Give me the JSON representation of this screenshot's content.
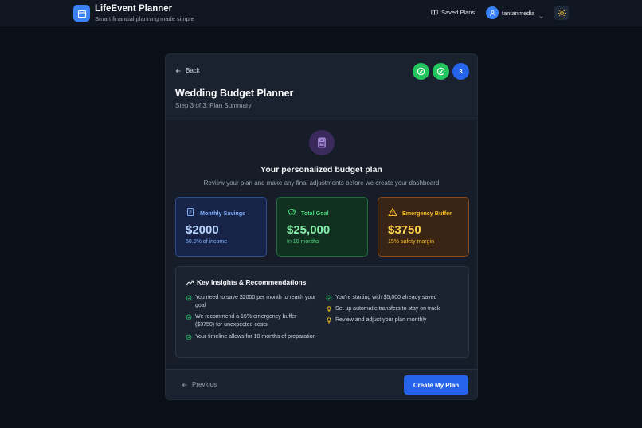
{
  "app": {
    "title": "LifeEvent Planner",
    "subtitle": "Smart financial planning made simple"
  },
  "topnav": {
    "saved_plans": "Saved Plans",
    "username": "tantanmedia"
  },
  "card": {
    "back_label": "Back",
    "title": "Wedding Budget Planner",
    "step_text": "Step 3 of 3: Plan Summary",
    "steps": [
      {
        "state": "complete"
      },
      {
        "state": "complete"
      },
      {
        "label": "3",
        "state": "current"
      }
    ]
  },
  "summary": {
    "title": "Your personalized budget plan",
    "subtitle": "Review your plan and make any final adjustments before we create your dashboard"
  },
  "stats": [
    {
      "label": "Monthly Savings",
      "value": "$2000",
      "note": "50.0% of income",
      "color": "#3b82f6",
      "icon": "document-icon"
    },
    {
      "label": "Total Goal",
      "value": "$25,000",
      "note": "In 10 months",
      "color": "#22c55e",
      "icon": "piggy-bank-icon"
    },
    {
      "label": "Emergency Buffer",
      "value": "$3750",
      "note": "15% safety margin",
      "color": "#f59e0b",
      "icon": "warning-icon"
    }
  ],
  "insights": {
    "title": "Key Insights & Recommendations",
    "left": [
      {
        "text": "You need to save $2000 per month to reach your goal",
        "icon": "check-circle-icon"
      },
      {
        "text": "We recommend a 15% emergency buffer ($3750) for unexpected costs",
        "icon": "check-circle-icon"
      },
      {
        "text": "Your timeline allows for 10 months of preparation",
        "icon": "check-circle-icon"
      }
    ],
    "right": [
      {
        "text": "You're starting with $5,000 already saved",
        "icon": "check-circle-icon"
      },
      {
        "text": "Set up automatic transfers to stay on track",
        "icon": "lightbulb-icon"
      },
      {
        "text": "Review and adjust your plan monthly",
        "icon": "lightbulb-icon"
      }
    ]
  },
  "footer": {
    "previous_label": "Previous",
    "create_label": "Create My Plan"
  }
}
